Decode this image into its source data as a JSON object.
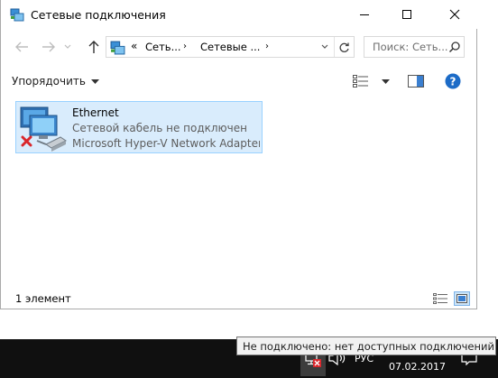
{
  "window": {
    "title": "Сетевые подключения",
    "icon": "network-connections-icon"
  },
  "controls": {
    "minimize": "minimize-icon",
    "maximize": "maximize-icon",
    "close": "close-icon"
  },
  "address": {
    "overflow": "«",
    "crumbs": [
      "Сеть...",
      "Сетевые ..."
    ],
    "separator": "›",
    "search_placeholder": "Поиск: Сеть..."
  },
  "toolbar": {
    "organize_label": "Упорядочить"
  },
  "items": [
    {
      "name": "Ethernet",
      "status": "Сетевой кабель не подключен",
      "device": "Microsoft Hyper-V Network Adapter",
      "state_icon": "disconnected-x-icon"
    }
  ],
  "statusbar": {
    "count": "1 элемент"
  },
  "taskbar": {
    "language": "РУС",
    "date": "07.02.2017"
  },
  "tooltip": {
    "text": "Не подключено: нет доступных подключений"
  },
  "colors": {
    "selection_bg": "#d9ecfc",
    "selection_border": "#99d1ff",
    "taskbar_bg": "#101010",
    "error_red": "#d9262b",
    "help_blue": "#1c6bc7"
  }
}
